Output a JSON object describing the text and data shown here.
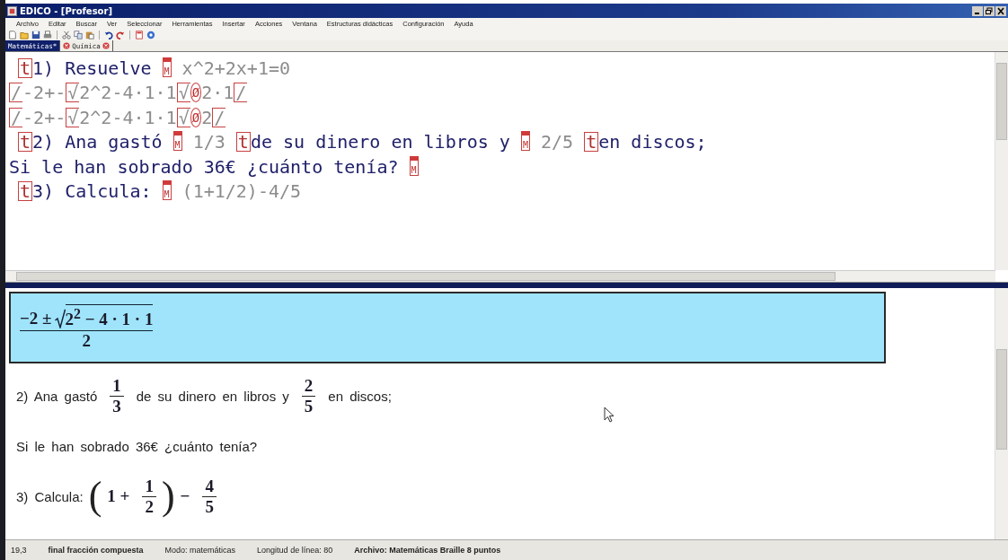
{
  "window": {
    "title": "EDICO - [Profesor]"
  },
  "menu": [
    "Archivo",
    "Editar",
    "Buscar",
    "Ver",
    "Seleccionar",
    "Herramientas",
    "Insertar",
    "Acciones",
    "Ventana",
    "Estructuras didácticas",
    "Configuración",
    "Ayuda"
  ],
  "tabs": [
    {
      "label": "Matemáticas*",
      "selected": true
    },
    {
      "label": "Química",
      "selected": false
    }
  ],
  "editor": {
    "lines": [
      {
        "indent": true,
        "segments": [
          {
            "kind": "tag",
            "text": "t"
          },
          {
            "kind": "text",
            "text": "1) Resuelve "
          },
          {
            "kind": "mode",
            "text": "M"
          },
          {
            "kind": "math",
            "text": " x^2+2x+1=0"
          }
        ]
      },
      {
        "indent": false,
        "segments": [
          {
            "kind": "box",
            "text": "/"
          },
          {
            "kind": "math",
            "text": "-2+-"
          },
          {
            "kind": "box",
            "text": "√"
          },
          {
            "kind": "math",
            "text": "2^2-4·1·1"
          },
          {
            "kind": "box",
            "text": "√"
          },
          {
            "kind": "circle",
            "text": "Ø"
          },
          {
            "kind": "math",
            "text": "2·1"
          },
          {
            "kind": "box",
            "text": "/"
          }
        ]
      },
      {
        "indent": false,
        "segments": [
          {
            "kind": "box",
            "text": "/"
          },
          {
            "kind": "math",
            "text": "-2+-"
          },
          {
            "kind": "box",
            "text": "√"
          },
          {
            "kind": "math",
            "text": "2^2-4·1·1"
          },
          {
            "kind": "box",
            "text": "√"
          },
          {
            "kind": "circle",
            "text": "Ø"
          },
          {
            "kind": "math",
            "text": "2"
          },
          {
            "kind": "box",
            "text": "/"
          }
        ]
      },
      {
        "indent": true,
        "segments": [
          {
            "kind": "tag",
            "text": "t"
          },
          {
            "kind": "text",
            "text": "2) Ana gastó "
          },
          {
            "kind": "mode",
            "text": "M"
          },
          {
            "kind": "math",
            "text": " 1/3 "
          },
          {
            "kind": "tag",
            "text": "t"
          },
          {
            "kind": "text",
            "text": "de su dinero en libros y "
          },
          {
            "kind": "mode",
            "text": "M"
          },
          {
            "kind": "math",
            "text": " 2/5 "
          },
          {
            "kind": "tag",
            "text": "t"
          },
          {
            "kind": "text",
            "text": "en discos;"
          }
        ]
      },
      {
        "indent": false,
        "segments": [
          {
            "kind": "text",
            "text": "Si le han sobrado 36€ ¿cuánto tenía? "
          },
          {
            "kind": "mode",
            "text": "M"
          }
        ]
      },
      {
        "indent": true,
        "segments": [
          {
            "kind": "tag",
            "text": "t"
          },
          {
            "kind": "text",
            "text": "3) Calcula: "
          },
          {
            "kind": "mode",
            "text": "M"
          },
          {
            "kind": "math",
            "text": " (1+1/2)-4/5"
          }
        ]
      }
    ]
  },
  "preview": {
    "display": {
      "before": "−2 ±",
      "radicand": "2$^{2}$ − 4 · 1 · 1",
      "denominator": "2"
    },
    "lines": [
      [
        {
          "kind": "text",
          "text": "2) Ana gastó"
        },
        {
          "kind": "frac",
          "num": "1",
          "den": "3"
        },
        {
          "kind": "text",
          "text": "de su dinero en libros y"
        },
        {
          "kind": "frac",
          "num": "2",
          "den": "5"
        },
        {
          "kind": "text",
          "text": "en discos;"
        }
      ],
      [
        {
          "kind": "text",
          "text": "Si le han sobrado 36€ ¿cuánto tenía?"
        }
      ],
      [
        {
          "kind": "text",
          "text": "3) Calcula:"
        },
        {
          "kind": "paren",
          "text": "("
        },
        {
          "kind": "mtext",
          "text": "1 +"
        },
        {
          "kind": "frac",
          "num": "1",
          "den": "2"
        },
        {
          "kind": "paren",
          "text": ")"
        },
        {
          "kind": "mtext",
          "text": "−"
        },
        {
          "kind": "frac",
          "num": "4",
          "den": "5"
        }
      ]
    ]
  },
  "status_bar": [
    {
      "text": "19,3",
      "bold": false
    },
    {
      "text": "final fracción compuesta",
      "bold": true
    },
    {
      "text": "Modo: matemáticas",
      "bold": false
    },
    {
      "text": "Longitud de línea: 80",
      "bold": false
    },
    {
      "text": "Archivo: Matemáticas  Braille 8 puntos",
      "bold": true
    }
  ]
}
